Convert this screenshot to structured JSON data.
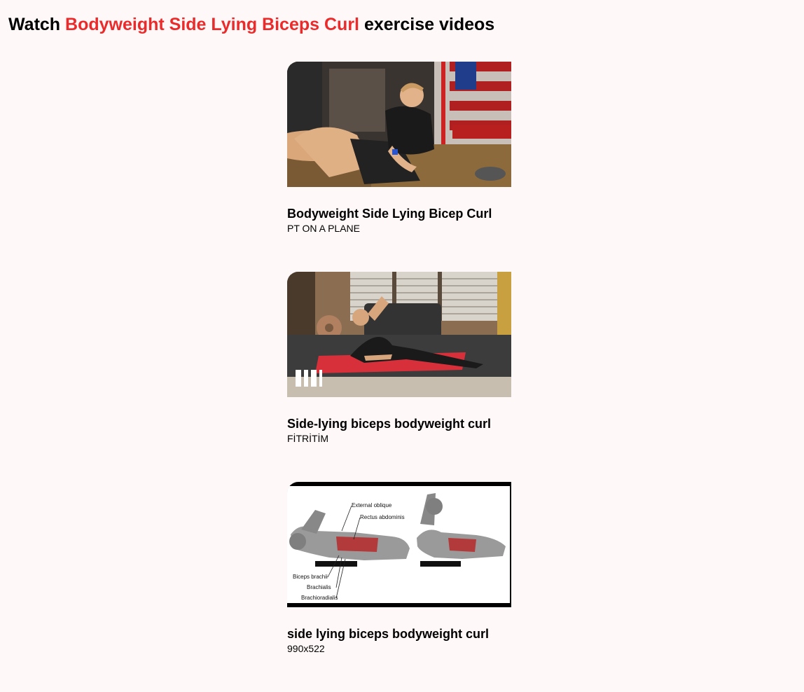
{
  "heading": {
    "prefix": "Watch",
    "exercise": "Bodyweight Side Lying Biceps Curl",
    "suffix": "exercise videos",
    "accent_color": "#ea2b2b"
  },
  "videos": [
    {
      "title": "Bodyweight Side Lying Bicep Curl",
      "channel": "PT ON A PLANE",
      "thumbnail": "gym-man-side-lying-photo"
    },
    {
      "title": "Side-lying biceps bodyweight curl",
      "channel": "FİTRİTİM",
      "thumbnail": "man-on-red-mat-photo"
    },
    {
      "title": "side lying biceps bodyweight curl",
      "channel": "990x522",
      "thumbnail": "anatomy-illustration",
      "diagram_labels": {
        "external_oblique": "External oblique",
        "rectus_abdominis": "Rectus abdominis",
        "biceps_brachii": "Biceps brachii",
        "brachialis": "Brachialis",
        "brachioradialis": "Brachioradialis"
      }
    }
  ]
}
